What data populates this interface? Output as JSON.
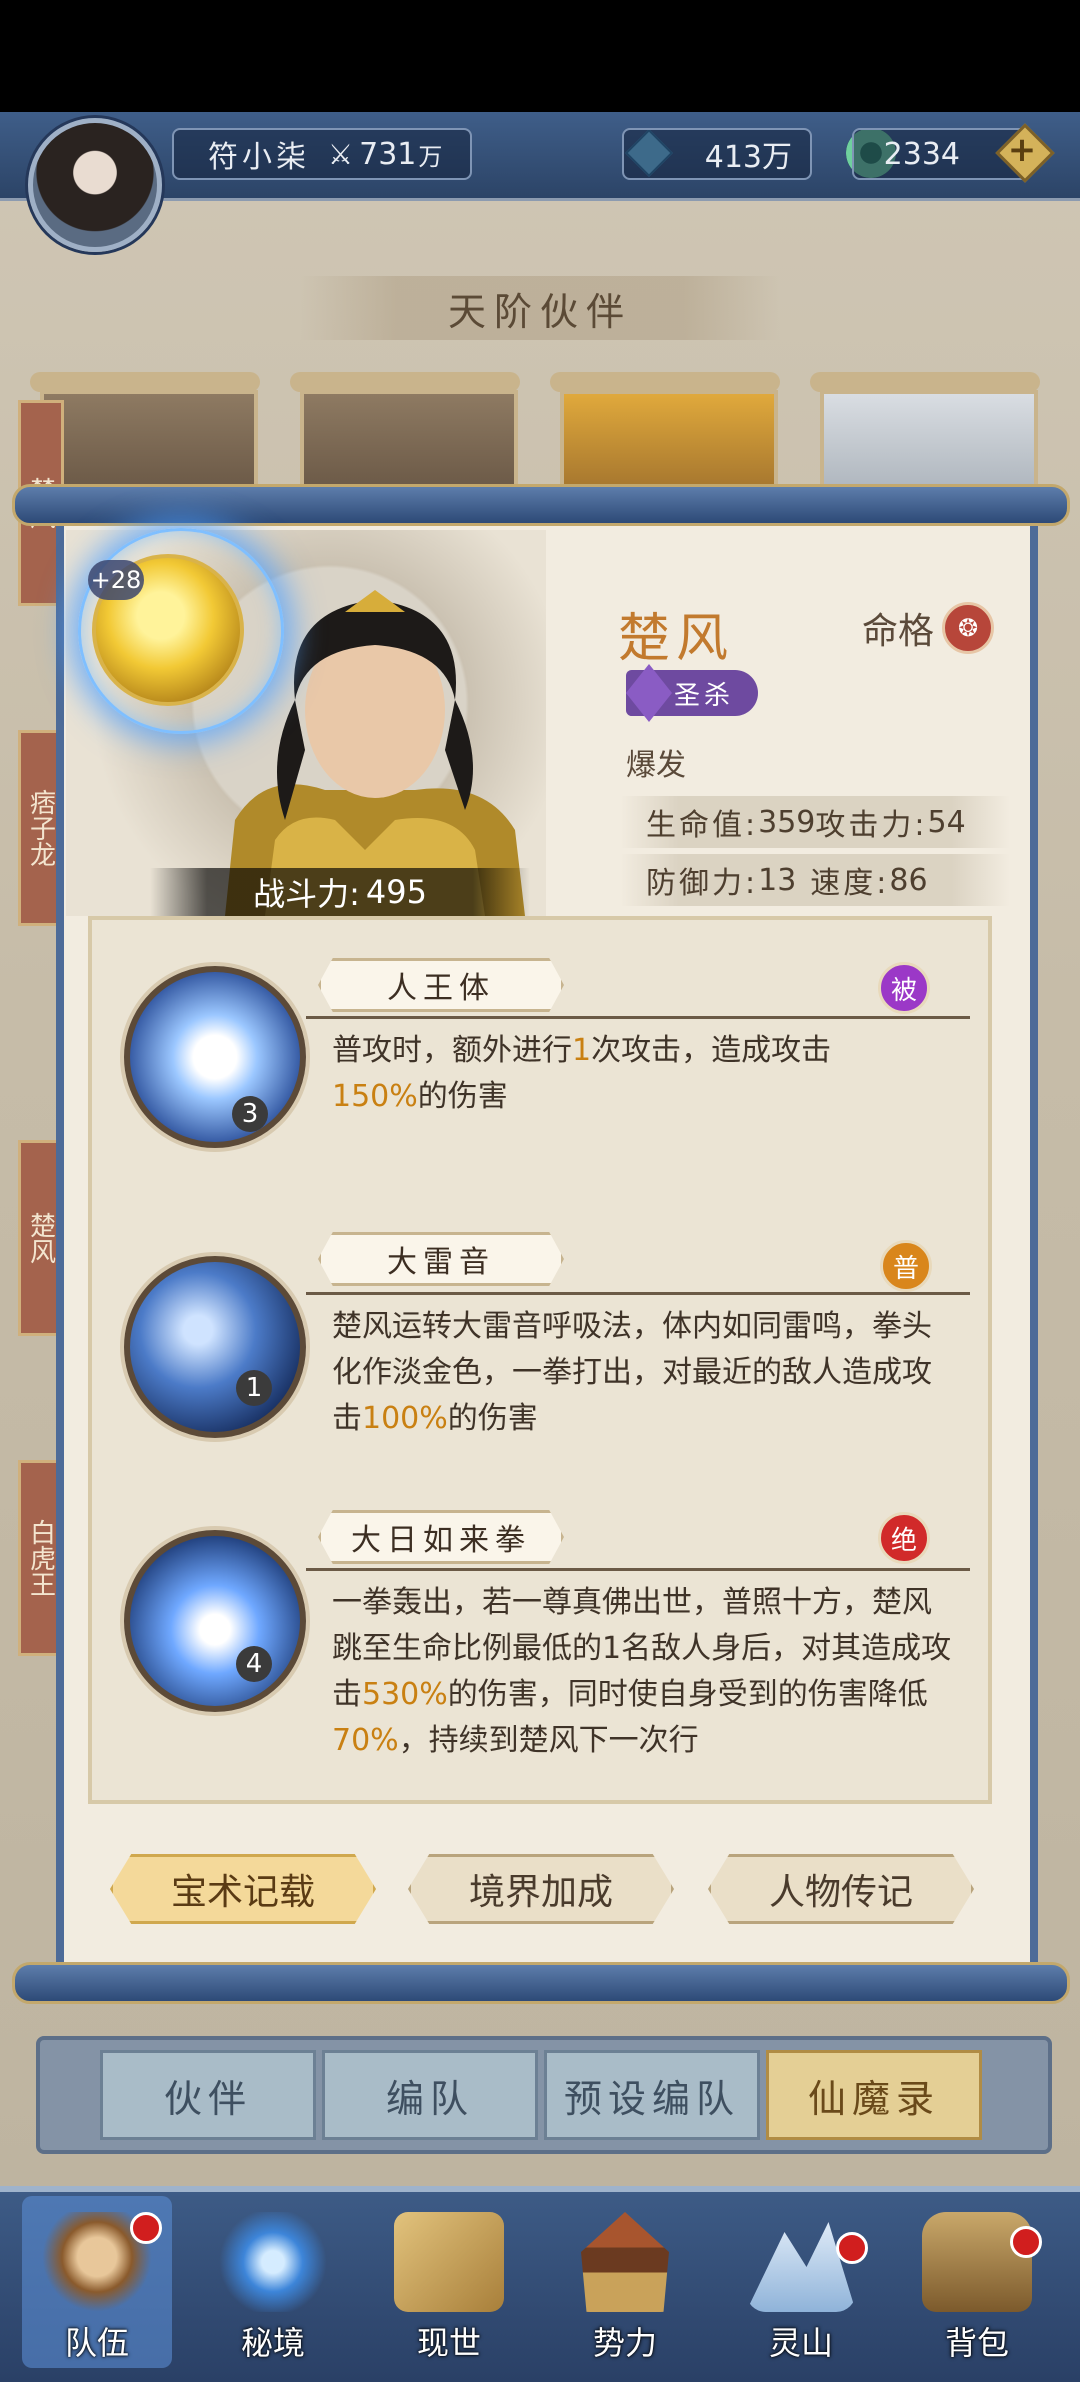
{
  "header": {
    "player_name": "符小柒",
    "power": "731",
    "power_unit": "万",
    "gold": "413万",
    "jade": "2334"
  },
  "section_title": "天阶伙伴",
  "background_cards": [
    {
      "tab": "楚风"
    },
    {
      "tab": "痞子龙"
    },
    {
      "tab": "楚风"
    },
    {
      "tab": "白虎王"
    }
  ],
  "character": {
    "plus": "+28",
    "name": "楚风",
    "mingge_label": "命格",
    "role": "圣杀",
    "type": "爆发",
    "hp_label": "生命值:",
    "hp": "359",
    "atk_label": "攻击力:",
    "atk": "54",
    "def_label": "防御力:",
    "def": "13",
    "spd_label": "速度:",
    "spd": "86",
    "power_label": "战斗力:",
    "power": "495"
  },
  "skills": [
    {
      "name": "人王体",
      "level": "3",
      "tag": "被",
      "tag_color": "#9b38c7",
      "desc_parts": [
        "普攻时，额外进行",
        "1",
        "次攻击，造成攻击",
        "150%",
        "的伤害"
      ]
    },
    {
      "name": "大雷音",
      "level": "1",
      "tag": "普",
      "tag_color": "#d9861b",
      "desc_parts": [
        "楚风运转大雷音呼吸法，体内如同雷鸣，拳头化作淡金色，一拳打出，对最近的敌人造成攻击",
        "100%",
        "的伤害"
      ]
    },
    {
      "name": "大日如来拳",
      "level": "4",
      "tag": "绝",
      "tag_color": "#d12a2a",
      "desc_parts": [
        "一拳轰出，若一尊真佛出世，普照十方，楚风跳至生命比例最低的1名敌人身后，对其造成攻击",
        "530%",
        "的伤害，同时使自身受到的伤害降低",
        "70%",
        "，持续到楚风下一次行"
      ]
    }
  ],
  "scroll_buttons": [
    "宝术记载",
    "境界加成",
    "人物传记"
  ],
  "tabs": [
    "伙伴",
    "编队",
    "预设编队",
    "仙魔录"
  ],
  "nav": [
    "队伍",
    "秘境",
    "现世",
    "势力",
    "灵山",
    "背包"
  ]
}
